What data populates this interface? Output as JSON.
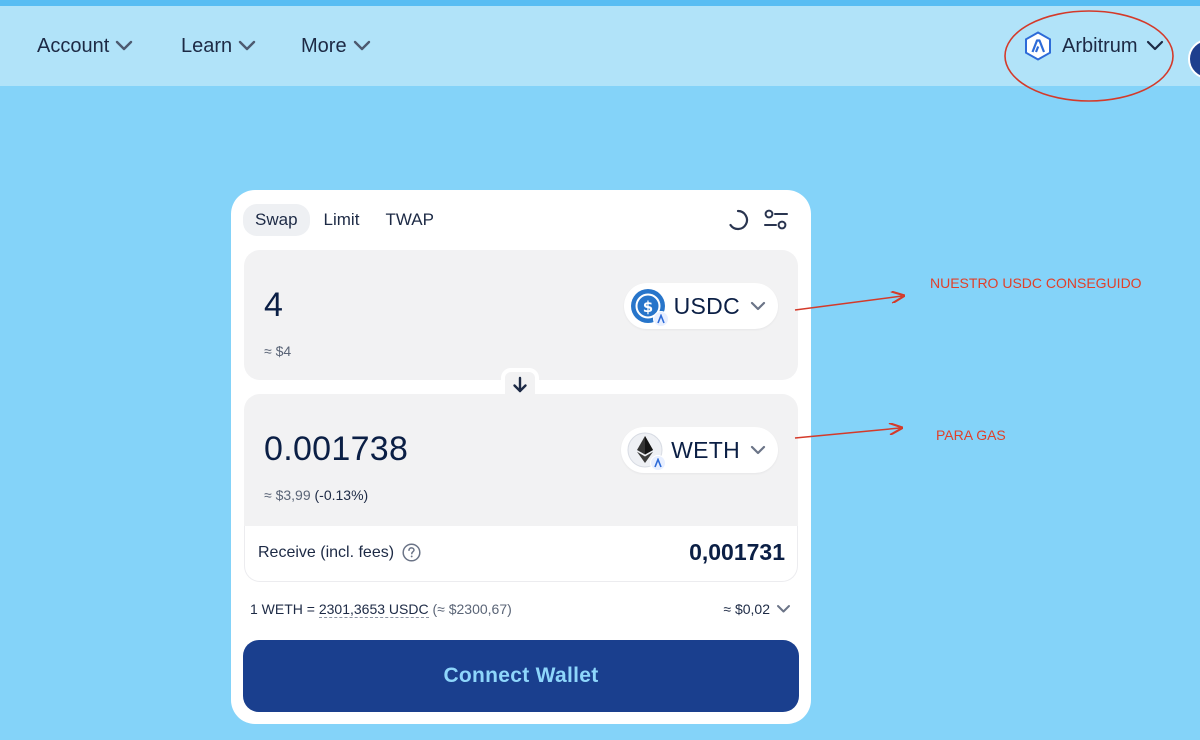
{
  "nav": {
    "items": [
      {
        "label": "Account"
      },
      {
        "label": "Learn"
      },
      {
        "label": "More"
      }
    ],
    "network": {
      "label": "Arbitrum",
      "icon": "arbitrum-logo-icon"
    }
  },
  "swap": {
    "tabs": [
      {
        "label": "Swap",
        "active": true
      },
      {
        "label": "Limit",
        "active": false
      },
      {
        "label": "TWAP",
        "active": false
      }
    ],
    "sell": {
      "amount": "4",
      "usd": "≈ $4",
      "token": "USDC"
    },
    "buy": {
      "amount": "0.001738",
      "usd": "≈ $3,99",
      "diff": "(-0.13%)",
      "token": "WETH"
    },
    "receive": {
      "label": "Receive (incl. fees)",
      "value": "0,001731"
    },
    "rate": {
      "prefix": "1 WETH = ",
      "value": "2301,3653 USDC",
      "usd": "(≈ $2300,67)"
    },
    "gas": "≈ $0,02",
    "connect_label": "Connect Wallet"
  },
  "annotations": {
    "usdc_note": "NUESTRO USDC CONSEGUIDO",
    "gas_note": "PARA GAS",
    "color": "#e0402a"
  },
  "colors": {
    "background": "#84d3f9",
    "nav": "#b1e3f9",
    "button": "#1a3f8e",
    "button_text": "#8ed6fb"
  }
}
